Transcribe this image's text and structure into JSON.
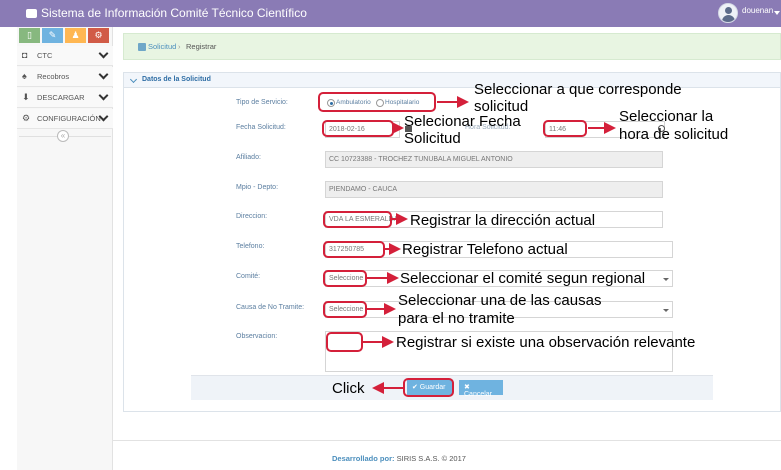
{
  "app": {
    "title": "Sistema de Información Comité Técnico Científico",
    "user": "douenan"
  },
  "sidebar": {
    "shortcuts": [
      "▯",
      "✎",
      "♟",
      "⚙"
    ],
    "items": [
      {
        "label": "CTC",
        "icon": "camera-icon"
      },
      {
        "label": "Recobros",
        "icon": "bell-icon"
      },
      {
        "label": "DESCARGAR",
        "icon": "download-icon"
      },
      {
        "label": "CONFIGURACIÓN",
        "icon": "gears-icon"
      }
    ],
    "collapse": "«"
  },
  "breadcrumb": {
    "home": "Solicitud",
    "separator": "›",
    "current": "Registrar"
  },
  "panel": {
    "title": "Datos de la Solicitud"
  },
  "form": {
    "tipo_servicio_label": "Tipo de Servicio:",
    "opt_ambulatorio": "Ambulatorio",
    "opt_hospitalario": "Hospitalario",
    "fecha_label": "Fecha Solicitud:",
    "fecha_value": "2018-02-16",
    "hora_label": "Hora Solicitud:",
    "hora_value": "11:46",
    "afiliado_label": "Afiliado:",
    "afiliado_value": "CC 10723388 - TROCHEZ TUNUBALA MIGUEL ANTONIO",
    "mpio_label": "Mpio - Depto:",
    "mpio_value": "PIENDAMO - CAUCA",
    "direccion_label": "Direccion:",
    "direccion_value": "VDA LA ESMERALDA",
    "telefono_label": "Telefono:",
    "telefono_value": "317250785",
    "comite_label": "Comité:",
    "comite_value": "Seleccione",
    "causa_label": "Causa de No Tramite:",
    "causa_value": "Seleccione",
    "observacion_label": "Observacion:",
    "observacion_value": ""
  },
  "buttons": {
    "save": "✔ Guardar",
    "cancel": "✖ Cancelar"
  },
  "footer": {
    "prefix": "Desarrollado por:",
    "text": "SIRIS S.A.S. © 2017"
  },
  "annotations": {
    "tipo": [
      "Seleccionar a que corresponde",
      "solicitud"
    ],
    "fecha": [
      "Selecionar Fecha",
      "Solicitud"
    ],
    "hora": [
      "Seleccionar la",
      "hora de solicitud"
    ],
    "direccion": "Registrar la dirección actual",
    "telefono": "Registrar Telefono actual",
    "comite": "Seleccionar el comité segun regional",
    "causa": [
      "Seleccionar una de las causas",
      "para el no tramite"
    ],
    "observacion": "Registrar si existe una observación relevante",
    "click": "Click"
  },
  "colors": {
    "topbar": "#8a7bb5",
    "annotation": "#d4203a",
    "button": "#6fb3e0"
  }
}
